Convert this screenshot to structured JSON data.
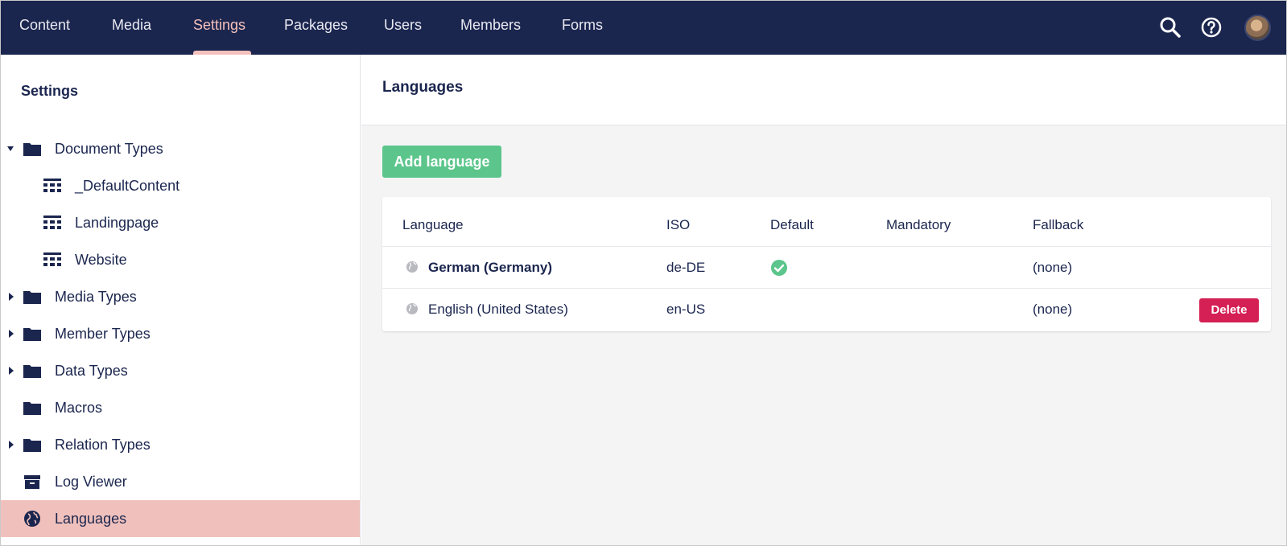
{
  "nav": {
    "items": [
      {
        "label": "Content"
      },
      {
        "label": "Media"
      },
      {
        "label": "Settings",
        "active": true
      },
      {
        "label": "Packages"
      },
      {
        "label": "Users"
      },
      {
        "label": "Members"
      },
      {
        "label": "Forms"
      }
    ],
    "icons": [
      "search-icon",
      "help-icon",
      "avatar"
    ]
  },
  "sidebar": {
    "title": "Settings",
    "items": [
      {
        "label": "Document Types",
        "icon": "folder-icon",
        "expanded": true
      },
      {
        "label": "_DefaultContent",
        "icon": "doc-type-icon",
        "child": true
      },
      {
        "label": "Landingpage",
        "icon": "doc-type-icon",
        "child": true
      },
      {
        "label": "Website",
        "icon": "doc-type-icon",
        "child": true
      },
      {
        "label": "Media Types",
        "icon": "folder-icon",
        "expanded": false
      },
      {
        "label": "Member Types",
        "icon": "folder-icon",
        "expanded": false
      },
      {
        "label": "Data Types",
        "icon": "folder-icon",
        "expanded": false
      },
      {
        "label": "Macros",
        "icon": "folder-icon"
      },
      {
        "label": "Relation Types",
        "icon": "folder-icon",
        "expanded": false
      },
      {
        "label": "Log Viewer",
        "icon": "archive-icon"
      },
      {
        "label": "Languages",
        "icon": "globe-icon",
        "selected": true
      }
    ]
  },
  "main": {
    "title": "Languages",
    "add_button": "Add language",
    "table": {
      "headers": [
        "Language",
        "ISO",
        "Default",
        "Mandatory",
        "Fallback"
      ],
      "rows": [
        {
          "language": "German (Germany)",
          "iso": "de-DE",
          "default": true,
          "mandatory": false,
          "fallback": "(none)",
          "bold": true
        },
        {
          "language": "English (United States)",
          "iso": "en-US",
          "default": false,
          "mandatory": false,
          "fallback": "(none)",
          "delete_label": "Delete"
        }
      ]
    }
  },
  "colors": {
    "topbar": "#1b264f",
    "active_nav": "#f5c1bc",
    "selected_row": "#f0c1bc",
    "add_button": "#5cc58b",
    "delete_button": "#d42054",
    "check": "#5cc58b"
  }
}
